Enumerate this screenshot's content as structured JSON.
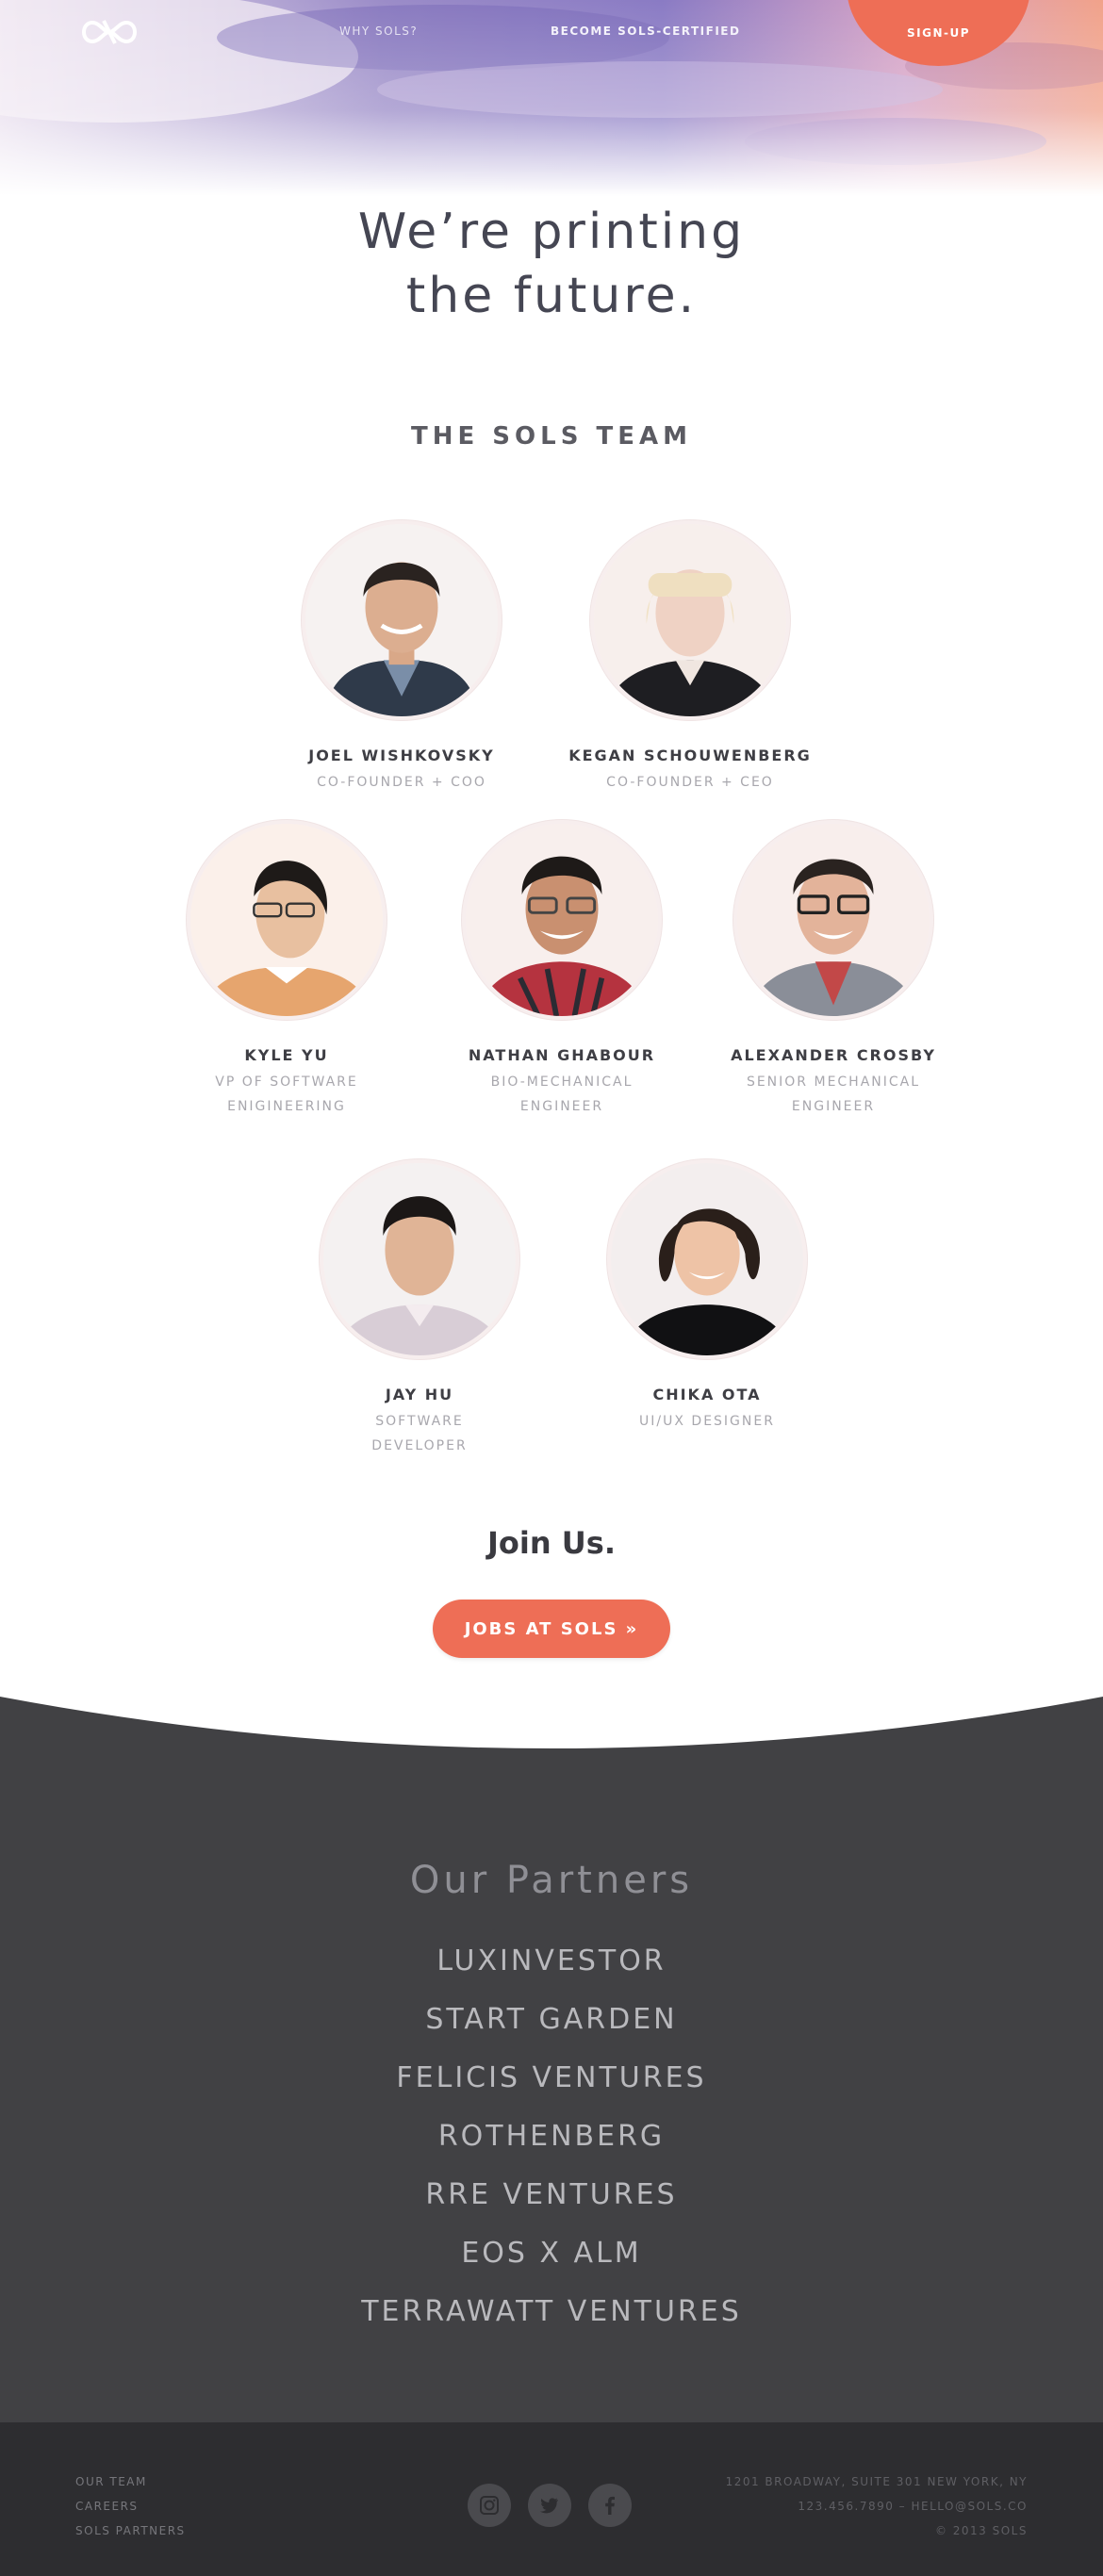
{
  "nav": {
    "logo_icon": "sols-infinity-logo",
    "why": "WHY SOLS?",
    "certified": "BECOME SOLS-CERTIFIED",
    "signup": "SIGN-UP"
  },
  "hero": {
    "line1": "We’re printing",
    "line2": "the future."
  },
  "team": {
    "title": "THE SOLS TEAM",
    "members": [
      {
        "name": "JOEL WISHKOVSKY",
        "role": "CO-FOUNDER + COO"
      },
      {
        "name": "KEGAN SCHOUWENBERG",
        "role": "CO-FOUNDER + CEO"
      },
      {
        "name": "KYLE YU",
        "role": "VP OF SOFTWARE ENIGINEERING"
      },
      {
        "name": "NATHAN GHABOUR",
        "role": "BIO-MECHANICAL ENGINEER"
      },
      {
        "name": "ALEXANDER CROSBY",
        "role": "SENIOR MECHANICAL ENGINEER"
      },
      {
        "name": "JAY HU",
        "role": "SOFTWARE DEVELOPER"
      },
      {
        "name": "CHIKA OTA",
        "role": "UI/UX DESIGNER"
      }
    ]
  },
  "join": {
    "title": "Join Us.",
    "button": "JOBS AT SOLS »"
  },
  "partners": {
    "title": "Our Partners",
    "items": [
      "LUXINVESTOR",
      "START GARDEN",
      "FELICIS VENTURES",
      "ROTHENBERG",
      "RRE VENTURES",
      "EOS X ALM",
      "TERRAWATT VENTURES"
    ]
  },
  "footer": {
    "links": [
      "OUR TEAM",
      "CAREERS",
      "SOLS PARTNERS"
    ],
    "social_icons": [
      "instagram-icon",
      "twitter-icon",
      "facebook-icon"
    ],
    "address": "1201 BROADWAY, SUITE 301 NEW YORK, NY",
    "contact": "123.456.7890 – HELLO@SOLS.CO",
    "copyright": "© 2013 SOLS"
  },
  "colors": {
    "accent": "#ee6e56",
    "dark_section": "#414144",
    "footer": "#2d2d30"
  }
}
